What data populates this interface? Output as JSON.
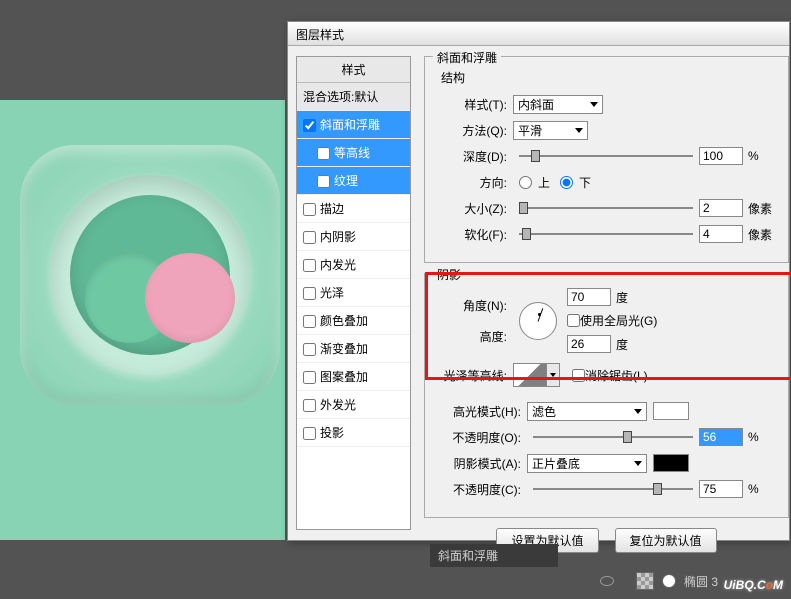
{
  "dialog": {
    "title": "图层样式"
  },
  "styleList": {
    "header": "样式",
    "blend": "混合选项:默认",
    "bevel": "斜面和浮雕",
    "contour": "等高线",
    "texture": "纹理",
    "stroke": "描边",
    "innerShadow": "内阴影",
    "innerGlow": "内发光",
    "satin": "光泽",
    "colorOverlay": "颜色叠加",
    "gradientOverlay": "渐变叠加",
    "patternOverlay": "图案叠加",
    "outerGlow": "外发光",
    "dropShadow": "投影"
  },
  "bevel": {
    "groupTitle": "斜面和浮雕",
    "structTitle": "结构",
    "styleLabel": "样式(T):",
    "styleValue": "内斜面",
    "methodLabel": "方法(Q):",
    "methodValue": "平滑",
    "depthLabel": "深度(D):",
    "depthValue": "100",
    "depthUnit": "%",
    "dirLabel": "方向:",
    "dirUp": "上",
    "dirDown": "下",
    "sizeLabel": "大小(Z):",
    "sizeValue": "2",
    "sizeUnit": "像素",
    "softenLabel": "软化(F):",
    "softenValue": "4",
    "softenUnit": "像素"
  },
  "shading": {
    "groupTitle": "阴影",
    "angleLabel": "角度(N):",
    "angleValue": "70",
    "angleUnit": "度",
    "globalLight": "使用全局光(G)",
    "altitudeLabel": "高度:",
    "altitudeValue": "26",
    "altitudeUnit": "度",
    "glossLabel": "光泽等高线:",
    "antialias": "消除锯齿(L)",
    "hlModeLabel": "高光模式(H):",
    "hlModeValue": "滤色",
    "hlColor": "#ffffff",
    "hlOpacityLabel": "不透明度(O):",
    "hlOpacityValue": "56",
    "hlOpacityUnit": "%",
    "shModeLabel": "阴影模式(A):",
    "shModeValue": "正片叠底",
    "shColor": "#000000",
    "shOpacityLabel": "不透明度(C):",
    "shOpacityValue": "75",
    "shOpacityUnit": "%"
  },
  "buttons": {
    "setDefault": "设置为默认值",
    "resetDefault": "复位为默认值"
  },
  "layer": {
    "tab": "斜面和浮雕",
    "name": "椭圆 3"
  },
  "watermark": {
    "t1": "UiB",
    "t2": "Q.C",
    "t3": "o",
    "t4": "M"
  }
}
